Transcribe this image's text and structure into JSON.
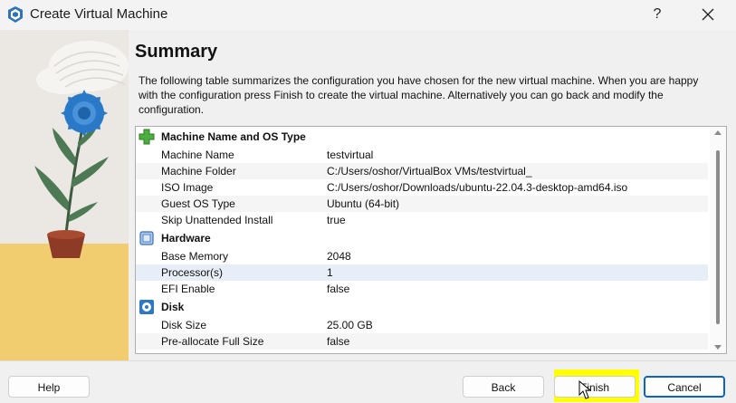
{
  "window": {
    "title": "Create Virtual Machine",
    "help_glyph": "?",
    "app_icon": "virtualbox-icon",
    "close_icon": "close-icon"
  },
  "page": {
    "title": "Summary",
    "description": "The following table summarizes the configuration you have chosen for the new virtual machine. When you are happy with the configuration press Finish to create the virtual machine. Alternatively you can go back and modify the configuration."
  },
  "sections": [
    {
      "label": "Machine Name and OS Type",
      "icon": "puzzle-plus-icon",
      "rows": [
        {
          "key": "Machine Name",
          "value": "testvirtual"
        },
        {
          "key": "Machine Folder",
          "value": "C:/Users/oshor/VirtualBox VMs/testvirtual_"
        },
        {
          "key": "ISO Image",
          "value": "C:/Users/oshor/Downloads/ubuntu-22.04.3-desktop-amd64.iso"
        },
        {
          "key": "Guest OS Type",
          "value": "Ubuntu (64-bit)"
        },
        {
          "key": "Skip Unattended Install",
          "value": "true"
        }
      ]
    },
    {
      "label": "Hardware",
      "icon": "chip-icon",
      "rows": [
        {
          "key": "Base Memory",
          "value": "2048"
        },
        {
          "key": "Processor(s)",
          "value": "1"
        },
        {
          "key": "EFI Enable",
          "value": "false"
        }
      ]
    },
    {
      "label": "Disk",
      "icon": "disk-icon",
      "rows": [
        {
          "key": "Disk Size",
          "value": "25.00 GB"
        },
        {
          "key": "Pre-allocate Full Size",
          "value": "false"
        }
      ]
    }
  ],
  "buttons": {
    "help": "Help",
    "back": "Back",
    "finish": "Finish",
    "cancel": "Cancel"
  },
  "colors": {
    "highlight": "#ffff00",
    "focus_border": "#0a64c8",
    "selected_row": "#e8eef7"
  }
}
